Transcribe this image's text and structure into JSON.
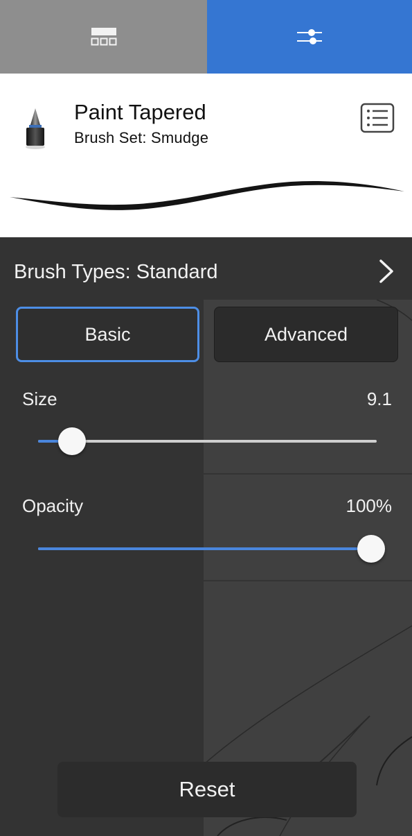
{
  "tabs": [
    {
      "name": "brush-library",
      "icon": "grid-icon",
      "color": "#8e8e8e"
    },
    {
      "name": "brush-settings",
      "icon": "sliders-icon",
      "color": "#3576d2"
    }
  ],
  "brush": {
    "name": "Paint Tapered",
    "set_label": "Brush Set: Smudge",
    "icon": "paint-brush-icon",
    "list_icon": "list-icon"
  },
  "panel": {
    "brush_types_label": "Brush Types: Standard",
    "chevron_icon": "chevron-right-icon",
    "segments": {
      "basic": "Basic",
      "advanced": "Advanced",
      "selected": "basic"
    },
    "sliders": [
      {
        "label": "Size",
        "value": "9.1",
        "fraction": 0.1
      },
      {
        "label": "Opacity",
        "value": "100%",
        "fraction": 1.0
      }
    ],
    "reset_label": "Reset"
  },
  "colors": {
    "accent": "#3576d2",
    "slider_fill": "#4a86dd",
    "panel_bg": "#333333"
  }
}
